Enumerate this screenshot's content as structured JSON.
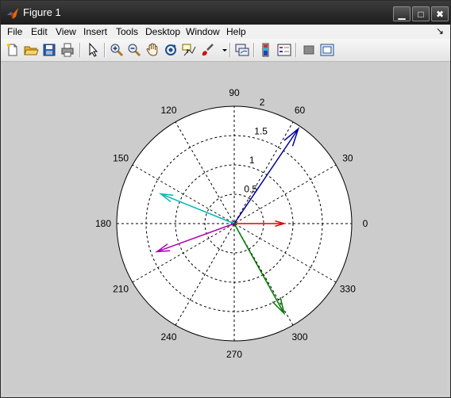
{
  "window": {
    "title": "Figure 1",
    "buttons": {
      "minimize": "▁",
      "maximize": "□",
      "close": "✖"
    }
  },
  "menu": {
    "items": [
      "File",
      "Edit",
      "View",
      "Insert",
      "Tools",
      "Desktop",
      "Window",
      "Help"
    ],
    "dock_arrow": "↘"
  },
  "toolbar": {
    "icons": [
      "new-figure-icon",
      "open-file-icon",
      "save-icon",
      "print-icon",
      "edit-plot-arrow-icon",
      "zoom-in-icon",
      "zoom-out-icon",
      "pan-hand-icon",
      "rotate-3d-icon",
      "data-cursor-icon",
      "brush-icon",
      "brush-dropdown-icon",
      "link-plot-icon",
      "colorbar-icon",
      "legend-icon",
      "hide-plot-tools-icon",
      "show-plot-tools-icon"
    ]
  },
  "chart_data": {
    "type": "compass",
    "angle_labels": [
      "0",
      "30",
      "60",
      "90",
      "120",
      "150",
      "180",
      "210",
      "240",
      "270",
      "300",
      "330"
    ],
    "radial_labels": [
      "0.5",
      "1",
      "1.5",
      "2"
    ],
    "rmax": 2,
    "grid": true,
    "arrows": [
      {
        "angle_deg": 0,
        "magnitude": 0.85,
        "color": "#e00000"
      },
      {
        "angle_deg": 56,
        "magnitude": 1.95,
        "color": "#000099"
      },
      {
        "angle_deg": 158,
        "magnitude": 1.35,
        "color": "#00b8b8"
      },
      {
        "angle_deg": 200,
        "magnitude": 1.4,
        "color": "#b000b0"
      },
      {
        "angle_deg": 299,
        "magnitude": 1.75,
        "color": "#007a00"
      }
    ]
  }
}
